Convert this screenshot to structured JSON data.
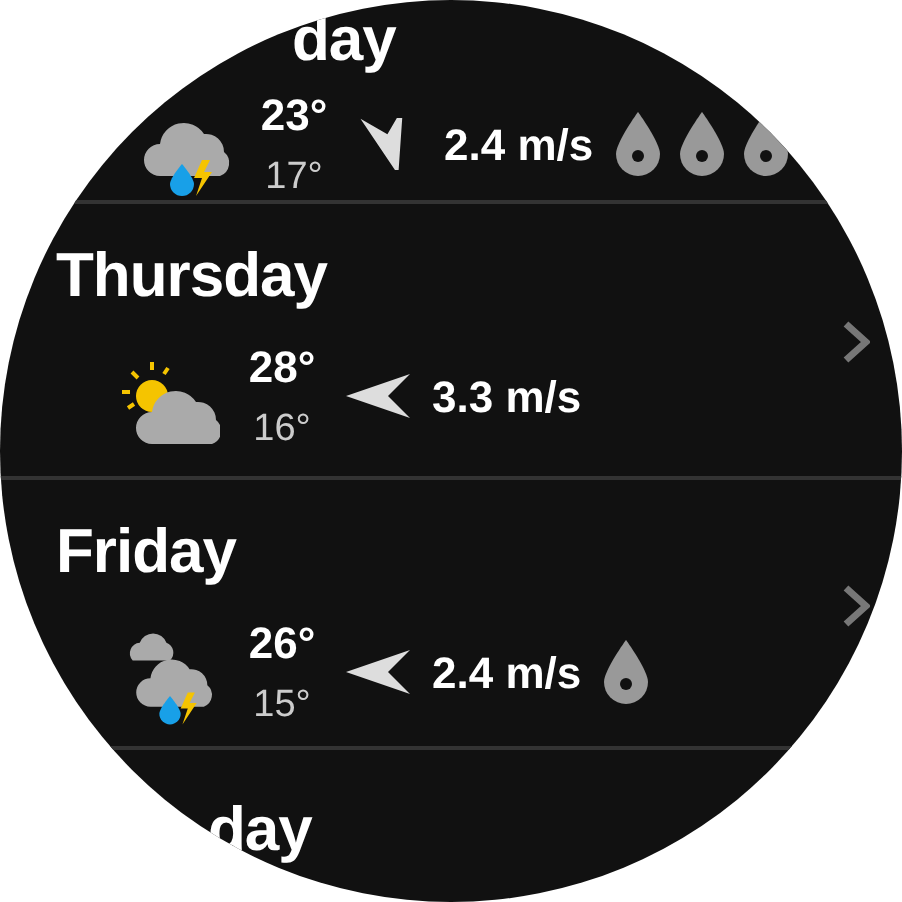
{
  "days": [
    {
      "kind": "partial-top",
      "name": "day",
      "weather": {
        "kind": "thunderstorm"
      },
      "high": "23°",
      "low": "17°",
      "wind_arrow": {
        "kind": "down"
      },
      "wind": "2.4 m/s",
      "rain": {
        "kind": "heavy"
      }
    },
    {
      "kind": "full",
      "name": "Thursday",
      "weather": {
        "kind": "partly-sunny"
      },
      "high": "28°",
      "low": "16°",
      "wind_arrow": {
        "kind": "left"
      },
      "wind": "3.3 m/s",
      "rain": {
        "kind": "none"
      }
    },
    {
      "kind": "full",
      "name": "Friday",
      "weather": {
        "kind": "heavy-thunderstorm"
      },
      "high": "26°",
      "low": "15°",
      "wind_arrow": {
        "kind": "left"
      },
      "wind": "2.4 m/s",
      "rain": {
        "kind": "light"
      }
    },
    {
      "kind": "partial-bottom",
      "name": "day"
    }
  ]
}
